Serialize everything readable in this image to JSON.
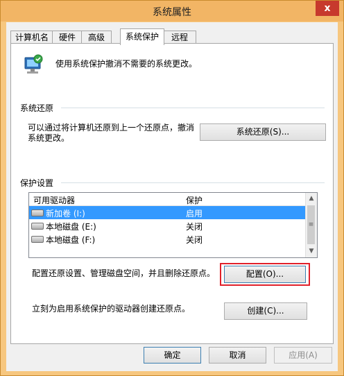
{
  "window": {
    "title": "系统属性",
    "close_label": "x",
    "tabs": [
      {
        "label": "计算机名"
      },
      {
        "label": "硬件"
      },
      {
        "label": "高级"
      },
      {
        "label": "系统保护",
        "active": true
      },
      {
        "label": "远程"
      }
    ]
  },
  "intro": {
    "text": "使用系统保护撤消不需要的系统更改。",
    "icon": "computer-protection-icon"
  },
  "restore": {
    "group_label": "系统还原",
    "description_line1": "可以通过将计算机还原到上一个还原点，撤消",
    "description_line2": "系统更改。",
    "button": "系统还原(S)..."
  },
  "protection": {
    "group_label": "保护设置",
    "columns": [
      "可用驱动器",
      "保护"
    ],
    "drives": [
      {
        "name": "新加卷 (I:)",
        "status": "启用",
        "selected": true
      },
      {
        "name": "本地磁盘 (E:)",
        "status": "关闭",
        "selected": false
      },
      {
        "name": "本地磁盘 (F:)",
        "status": "关闭",
        "selected": false
      }
    ],
    "configure_text": "配置还原设置、管理磁盘空间，并且删除还原点。",
    "configure_button": "配置(O)...",
    "create_text": "立刻为启用系统保护的驱动器创建还原点。",
    "create_button": "创建(C)..."
  },
  "footer": {
    "ok": "确定",
    "cancel": "取消",
    "apply": "应用(A)"
  },
  "colors": {
    "title_bar": "#f2b565",
    "close_button": "#c7392d",
    "selection": "#3399ff",
    "highlight_box": "#e0202a"
  }
}
